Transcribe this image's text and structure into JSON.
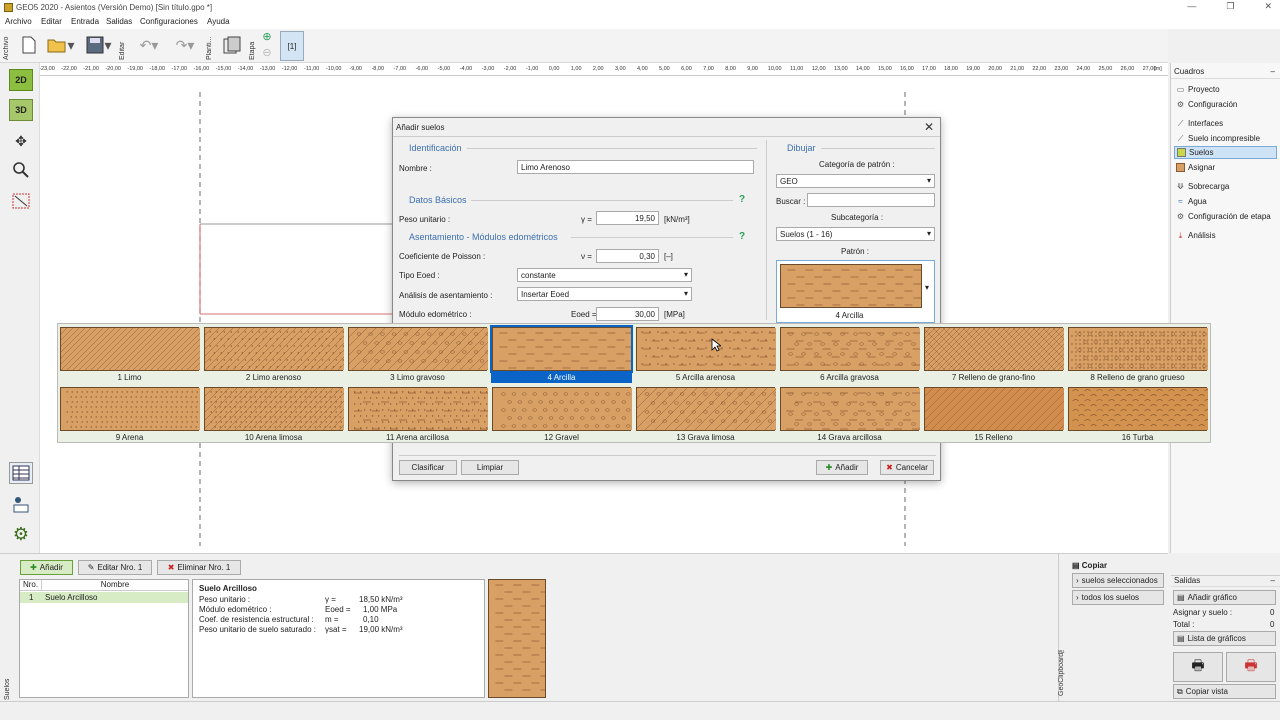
{
  "window": {
    "title": "GEO5 2020 - Asientos (Versión Demo) [Sin título.gpo *]"
  },
  "menu": [
    "Archivo",
    "Editar",
    "Entrada",
    "Salidas",
    "Configuraciones",
    "Ayuda"
  ],
  "toolbar": {
    "archivo_label": "Archivo",
    "editar_label": "Editar",
    "plantilla_label": "Planti...",
    "etapa_label": "Etapa",
    "stage_label": "[1]"
  },
  "ruler": {
    "ticks": [
      "-23,00",
      "-22,00",
      "-21,00",
      "-20,00",
      "-19,00",
      "-18,00",
      "-17,00",
      "-16,00",
      "-15,00",
      "-14,00",
      "-13,00",
      "-12,00",
      "-11,00",
      "-10,00",
      "-9,00",
      "-8,00",
      "-7,00",
      "-6,00",
      "-5,00",
      "-4,00",
      "-3,00",
      "-2,00",
      "-1,00",
      "0,00",
      "1,00",
      "2,00",
      "3,00",
      "4,00",
      "5,00",
      "6,00",
      "7,00",
      "8,00",
      "9,00",
      "10,00",
      "11,00",
      "12,00",
      "13,00",
      "14,00",
      "15,00",
      "16,00",
      "17,00",
      "18,00",
      "19,00",
      "20,00",
      "21,00",
      "22,00",
      "23,00",
      "24,00",
      "25,00",
      "26,00",
      "27,00"
    ],
    "unit": "[m]"
  },
  "left_tools": {
    "view2d": "2D",
    "view3d": "3D"
  },
  "right_panel": {
    "header": "Cuadros",
    "items": [
      "Proyecto",
      "Configuración",
      "Interfaces",
      "Suelo incompresible",
      "Suelos",
      "Asignar",
      "Sobrecarga",
      "Agua",
      "Configuración de etapa",
      "Análisis"
    ],
    "selected": "Suelos"
  },
  "dialog": {
    "title": "Añadir suelos",
    "identificacion": "Identificación",
    "nombre_label": "Nombre :",
    "nombre_value": "Limo Arenoso",
    "datos_basicos": "Datos Básicos",
    "peso_label": "Peso unitario :",
    "peso_symbol": "γ =",
    "peso_value": "19,50",
    "peso_unit": "[kN/m³]",
    "asentamiento": "Asentamiento - Módulos edométricos",
    "poisson_label": "Coeficiente de Poisson :",
    "poisson_symbol": "ν =",
    "poisson_value": "0,30",
    "poisson_unit": "[–]",
    "tipo_label": "Tipo Eoed :",
    "tipo_value": "constante",
    "analisis_label": "Análisis de asentamiento :",
    "analisis_value": "Insertar Eoed",
    "modulo_label": "Módulo edométrico :",
    "modulo_symbol": "Eoed =",
    "modulo_value": "30,00",
    "modulo_unit": "[MPa]",
    "help": "?",
    "dibujar": "Dibujar",
    "categoria_label": "Categoría de patrón :",
    "categoria_value": "GEO",
    "buscar_label": "Buscar :",
    "buscar_value": "",
    "subcategoria_label": "Subcategoría :",
    "subcategoria_value": "Suelos (1 - 16)",
    "patron_label": "Patrón :",
    "patron_value": "4 Arcilla",
    "clasificar": "Clasificar",
    "limpiar": "Limpiar",
    "anadir": "Añadir",
    "cancelar": "Cancelar"
  },
  "patterns": {
    "selected": "4 Arcilla",
    "items": [
      "1 Limo",
      "2 Limo arenoso",
      "3 Limo gravoso",
      "4 Arcilla",
      "5 Arcilla arenosa",
      "6 Arcilla gravosa",
      "7 Relleno de grano-fino",
      "8 Relleno de grano grueso",
      "9 Arena",
      "10 Arena limosa",
      "11 Arena arcillosa",
      "12 Gravel",
      "13 Grava limosa",
      "14 Grava arcillosa",
      "15 Relleno",
      "16 Turba"
    ]
  },
  "bottom": {
    "anadir": "Añadir",
    "editar": "Editar Nro. 1",
    "eliminar": "Eliminar Nro. 1",
    "col_nro": "Nro.",
    "col_nombre": "Nombre",
    "row_nro": "1",
    "row_nombre": "Suelo Arcilloso",
    "detail_title": "Suelo Arcilloso",
    "d1_label": "Peso unitario :",
    "d1_sym": "γ =",
    "d1_val": "18,50 kN/m³",
    "d2_label": "Módulo edométrico :",
    "d2_sym": "Eoed =",
    "d2_val": "1,00 MPa",
    "d3_label": "Coef. de resistencia estructural :",
    "d3_sym": "m =",
    "d3_val": "0,10",
    "d4_label": "Peso unitario de suelo saturado :",
    "d4_sym": "γsat =",
    "d4_val": "19,00 kN/m³",
    "suelos_tab": "Suelos",
    "copiar": "Copiar",
    "sel_suelos": "suelos seleccionados",
    "todos_suelos": "todos los suelos",
    "geoclipboard": "GeoClipboard™"
  },
  "salidas": {
    "header": "Salidas",
    "anadir_grafico": "Añadir gráfico",
    "asignar_label": "Asignar y suelo :",
    "asignar_val": "0",
    "total_label": "Total :",
    "total_val": "0",
    "lista": "Lista de gráficos",
    "copiar_vista": "Copiar vista"
  },
  "colors": {
    "soil": "#d9a066",
    "soil_dark": "#8a5a30",
    "accent": "#0a64c8",
    "section": "#3d6fb0"
  }
}
